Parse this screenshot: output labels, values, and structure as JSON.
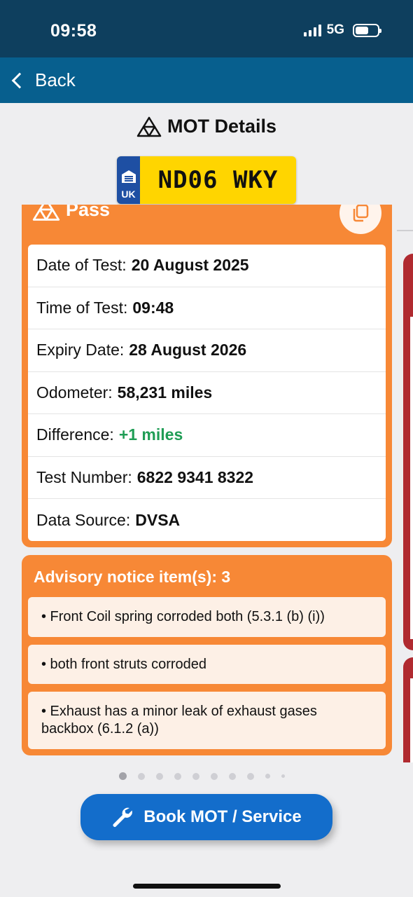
{
  "status": {
    "time": "09:58",
    "network": "5G"
  },
  "nav": {
    "back_label": "Back"
  },
  "page": {
    "title": "MOT Details"
  },
  "plate": {
    "country": "UK",
    "registration": "ND06 WKY"
  },
  "result": {
    "status": "Pass",
    "details": [
      {
        "label": "Date of Test:",
        "value": "20 August 2025",
        "color": ""
      },
      {
        "label": "Time of Test:",
        "value": "09:48",
        "color": ""
      },
      {
        "label": "Expiry Date:",
        "value": "28 August 2026",
        "color": ""
      },
      {
        "label": "Odometer:",
        "value": "58,231 miles",
        "color": ""
      },
      {
        "label": "Difference:",
        "value": "+1 miles",
        "color": "#1f9d55"
      },
      {
        "label": "Test Number:",
        "value": "6822 9341 8322",
        "color": ""
      },
      {
        "label": "Data Source:",
        "value": "DVSA",
        "color": ""
      }
    ]
  },
  "advisory": {
    "title": "Advisory notice item(s): 3",
    "items": [
      "• Front Coil spring corroded  both (5.3.1 (b) (i))",
      "• both front struts corroded",
      "• Exhaust has a minor leak of exhaust gases backbox (6.1.2 (a))"
    ]
  },
  "pager": {
    "page_count": 10,
    "active_index": 0
  },
  "actions": {
    "book_label": "Book MOT / Service"
  },
  "colors": {
    "card_orange": "#f78836",
    "nav_blue": "#075f8e",
    "status_navy": "#0e3f5e",
    "button_blue": "#136dcb",
    "fail_red": "#b02a30"
  }
}
